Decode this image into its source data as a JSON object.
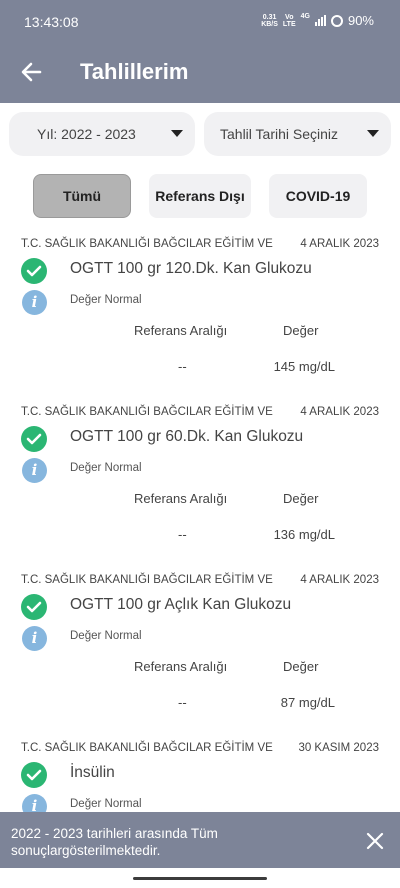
{
  "status_bar": {
    "time": "13:43:08",
    "net_speed_value": "0.31",
    "net_speed_unit": "KB/S",
    "volte_top": "Vo",
    "volte_bottom": "LTE",
    "signal_label": "4G",
    "battery": "90%"
  },
  "app_bar": {
    "title": "Tahlillerim",
    "back_icon": "arrow-left-icon"
  },
  "filters": {
    "year_dropdown": "Yıl: 2022 - 2023",
    "date_dropdown": "Tahlil Tarihi Seçiniz",
    "tabs": [
      "Tümü",
      "Referans Dışı",
      "COVID-19"
    ],
    "active_tab": "Tümü"
  },
  "results": [
    {
      "institution": "T.C. SAĞLIK BAKANLIĞI BAĞCILAR EĞİTİM VE",
      "date": "4 ARALIK 2023",
      "test_name": "OGTT 100 gr 120.Dk. Kan Glukozu",
      "status": "Değer Normal",
      "ref_header": "Referans Aralığı",
      "value_header": "Değer",
      "ref_value": "--",
      "value": "145 mg/dL"
    },
    {
      "institution": "T.C. SAĞLIK BAKANLIĞI BAĞCILAR EĞİTİM VE",
      "date": "4 ARALIK 2023",
      "test_name": "OGTT 100 gr 60.Dk. Kan Glukozu",
      "status": "Değer Normal",
      "ref_header": "Referans Aralığı",
      "value_header": "Değer",
      "ref_value": "--",
      "value": "136 mg/dL"
    },
    {
      "institution": "T.C. SAĞLIK BAKANLIĞI BAĞCILAR EĞİTİM VE",
      "date": "4 ARALIK 2023",
      "test_name": "OGTT 100 gr Açlık Kan Glukozu",
      "status": "Değer Normal",
      "ref_header": "Referans Aralığı",
      "value_header": "Değer",
      "ref_value": "--",
      "value": "87 mg/dL"
    },
    {
      "institution": "T.C. SAĞLIK BAKANLIĞI BAĞCILAR EĞİTİM VE",
      "date": "30 KASIM 2023",
      "test_name": "İnsülin",
      "status": "Değer Normal"
    }
  ],
  "toast": {
    "message": "2022 - 2023 tarihleri arasında Tüm sonuçlargösterilmektedir.",
    "close_icon": "close-icon"
  },
  "colors": {
    "header": "#7d8498",
    "check": "#2bb673",
    "info": "#86b6de",
    "active_tab": "#b3b3b3"
  }
}
